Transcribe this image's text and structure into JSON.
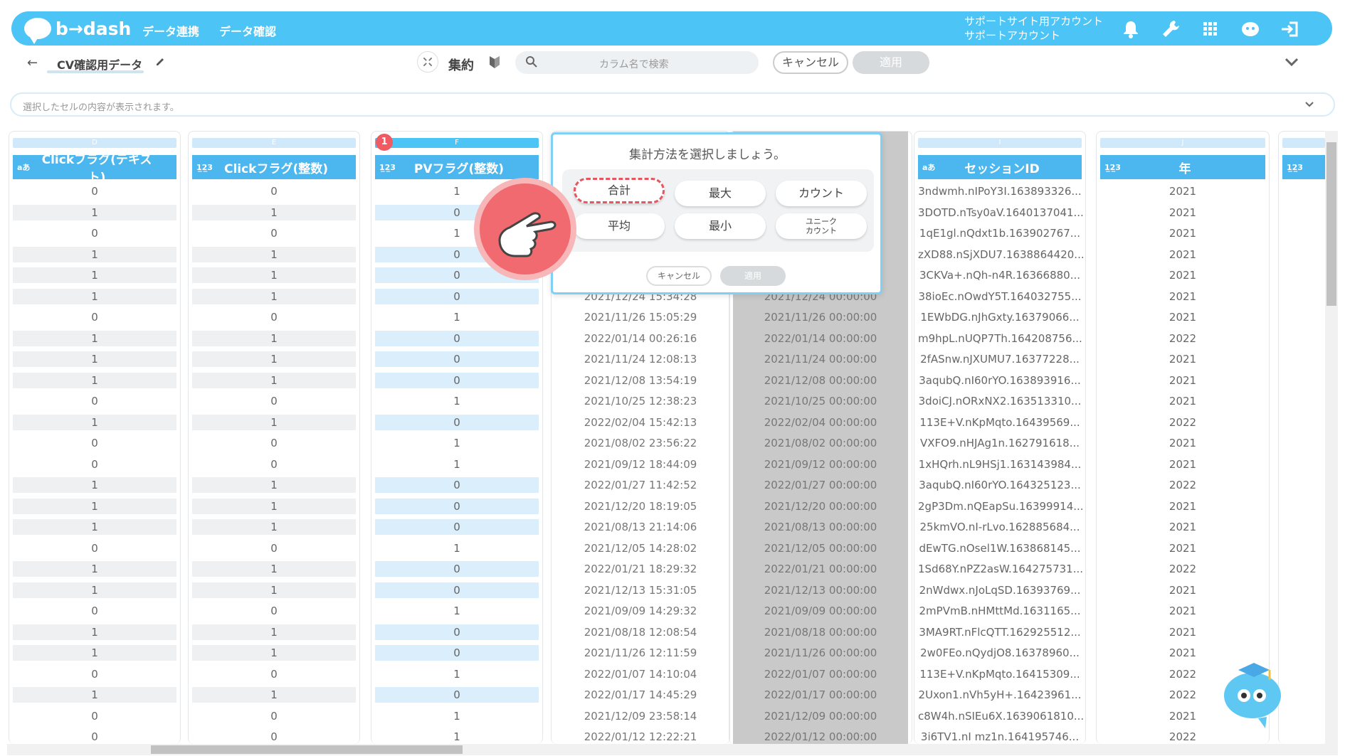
{
  "app": {
    "brand": "b→dash"
  },
  "nav": {
    "item1": "データ連携",
    "item2": "データ確認"
  },
  "account": {
    "line1": "サポートサイト用アカウント",
    "line2": "サポートアカウント"
  },
  "icons": {
    "bell": "bell-icon",
    "wrench": "wrench-icon",
    "grid": "grid-icon",
    "chat": "chat-mascot-icon",
    "logout": "logout-icon"
  },
  "subbar": {
    "back": "←",
    "title": "CV確認用データ",
    "aggregate_label": "集約",
    "search_placeholder": "カラム名で検索",
    "cancel": "キャンセル",
    "apply": "適用"
  },
  "cellbar": {
    "placeholder": "選択したセルの内容が表示されます。"
  },
  "columns": [
    {
      "letter": "D",
      "type": "aあ",
      "name": "Clickフラグ(テキスト)"
    },
    {
      "letter": "E",
      "type": "1̲2̲3",
      "name": "Clickフラグ(整数)"
    },
    {
      "letter": "F",
      "type": "1̲2̲3",
      "name": "PVフラグ(整数)"
    },
    {
      "letter": "I",
      "type": "aあ",
      "name": "セッションID"
    },
    {
      "letter": "J",
      "type": "1̲2̲3",
      "name": "年"
    },
    {
      "letter": "",
      "type": "1̲2̲3",
      "name": ""
    }
  ],
  "badge": "1",
  "rows": [
    [
      "0",
      "0",
      "1",
      "",
      "",
      "3ndwmh.nIPoY3I.163893326...",
      "2021"
    ],
    [
      "1",
      "1",
      "0",
      "",
      "",
      "3DOTD.nTsy0aV.1640137041...",
      "2021"
    ],
    [
      "0",
      "0",
      "1",
      "",
      "",
      "1qE1gl.nQdxt1b.163902767...",
      "2021"
    ],
    [
      "1",
      "1",
      "0",
      "",
      "",
      "zXD88.nSjXDU7.1638864420...",
      "2021"
    ],
    [
      "1",
      "1",
      "0",
      "",
      "",
      "3CKVa+.nQh-n4R.16366880...",
      "2021"
    ],
    [
      "1",
      "1",
      "0",
      "2021/12/24 15:34:28",
      "2021/12/24 00:00:00",
      "38ioEc.nOwdY5T.164032755...",
      "2021"
    ],
    [
      "0",
      "0",
      "1",
      "2021/11/26 15:05:29",
      "2021/11/26 00:00:00",
      "1EWbDG.nJhGxty.16379066...",
      "2021"
    ],
    [
      "1",
      "1",
      "0",
      "2022/01/14 00:26:16",
      "2022/01/14 00:00:00",
      "m9hpL.nUQP7Th.164208756...",
      "2022"
    ],
    [
      "1",
      "1",
      "0",
      "2021/11/24 12:08:13",
      "2021/11/24 00:00:00",
      "2fASnw.nJXUMU7.16377228...",
      "2021"
    ],
    [
      "1",
      "1",
      "0",
      "2021/12/08 13:54:19",
      "2021/12/08 00:00:00",
      "3aqubQ.nI60rYO.163893916...",
      "2021"
    ],
    [
      "0",
      "0",
      "1",
      "2021/10/25 12:38:23",
      "2021/10/25 00:00:00",
      "3doiCJ.nORxNX2.163513310...",
      "2021"
    ],
    [
      "1",
      "1",
      "0",
      "2022/02/04 15:42:13",
      "2022/02/04 00:00:00",
      "113E+V.nKpMqto.16439569...",
      "2022"
    ],
    [
      "0",
      "0",
      "1",
      "2021/08/02 23:56:22",
      "2021/08/02 00:00:00",
      "VXFO9.nHJAg1n.162791618...",
      "2021"
    ],
    [
      "0",
      "0",
      "1",
      "2021/09/12 18:44:09",
      "2021/09/12 00:00:00",
      "1xHQrh.nL9HSj1.163143984...",
      "2021"
    ],
    [
      "1",
      "1",
      "0",
      "2022/01/27 11:42:52",
      "2022/01/27 00:00:00",
      "3aqubQ.nI60rYO.164325123...",
      "2022"
    ],
    [
      "1",
      "1",
      "0",
      "2021/12/20 18:19:05",
      "2021/12/20 00:00:00",
      "2gP3Dm.nQEapSu.16399914...",
      "2021"
    ],
    [
      "1",
      "1",
      "0",
      "2021/08/13 21:14:06",
      "2021/08/13 00:00:00",
      "25kmVO.nI-rLvo.162885684...",
      "2021"
    ],
    [
      "0",
      "0",
      "1",
      "2021/12/05 14:28:02",
      "2021/12/05 00:00:00",
      "dEwTG.nOsel1W.163868145...",
      "2021"
    ],
    [
      "1",
      "1",
      "0",
      "2022/01/21 18:29:32",
      "2022/01/21 00:00:00",
      "1Sd68Y.nPZ2asW.164275731...",
      "2022"
    ],
    [
      "1",
      "1",
      "0",
      "2021/12/13 15:31:05",
      "2021/12/13 00:00:00",
      "2nWdwx.nJoLqSD.16393769...",
      "2021"
    ],
    [
      "0",
      "0",
      "1",
      "2021/09/09 14:29:32",
      "2021/09/09 00:00:00",
      "2mPVmB.nHMttMd.1631165...",
      "2021"
    ],
    [
      "1",
      "1",
      "0",
      "2021/08/18 12:08:54",
      "2021/08/18 00:00:00",
      "3MA9RT.nFlcQTT.162925512...",
      "2021"
    ],
    [
      "1",
      "1",
      "0",
      "2021/11/26 12:11:59",
      "2021/11/26 00:00:00",
      "2w0FEo.nQydjO8.16378960...",
      "2021"
    ],
    [
      "0",
      "0",
      "1",
      "2022/01/07 14:10:04",
      "2022/01/07 00:00:00",
      "113E+V.nKpMqto.16415309...",
      "2022"
    ],
    [
      "1",
      "1",
      "0",
      "2022/01/17 14:45:29",
      "2022/01/17 00:00:00",
      "2Uxon1.nVh5yH+.16423961...",
      "2022"
    ],
    [
      "0",
      "0",
      "1",
      "2021/12/09 23:58:14",
      "2021/12/09 00:00:00",
      "c8W4h.nSIEu6X.1639061810...",
      "2021"
    ],
    [
      "0",
      "0",
      "1",
      "2022/01/12 12:22:21",
      "2022/01/12 00:00:00",
      "3i6TV1.nI mz1n.164195746...",
      "2022"
    ]
  ],
  "popup": {
    "title": "集計方法を選択しましょう。",
    "options": [
      "合計",
      "最大",
      "カウント",
      "平均",
      "最小",
      "ユニーク\nカウント"
    ],
    "cancel": "キャンセル",
    "apply": "適用"
  },
  "colors": {
    "brand": "#4cc4f5",
    "header": "#4cb6ef",
    "highlight": "#e65560"
  }
}
